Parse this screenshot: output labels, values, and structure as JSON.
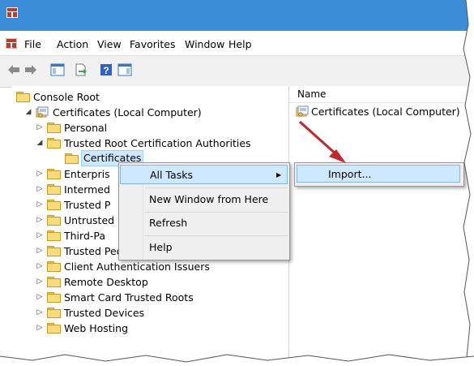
{
  "menu": [
    "File",
    "Action",
    "View",
    "Favorites",
    "Window",
    "Help"
  ],
  "toolbar": {
    "icons": [
      "back-arrow-icon",
      "forward-arrow-icon",
      "show-hide-tree-icon",
      "export-list-icon",
      "help-icon",
      "show-action-pane-icon"
    ]
  },
  "tree": [
    {
      "label": "Console Root",
      "indent": 0,
      "expander": "",
      "icon": "folder"
    },
    {
      "label": "Certificates (Local Computer)",
      "indent": 1,
      "expander": "◢",
      "icon": "cert"
    },
    {
      "label": "Personal",
      "indent": 2,
      "expander": "▷",
      "icon": "folder"
    },
    {
      "label": "Trusted Root Certification Authorities",
      "indent": 2,
      "expander": "◢",
      "icon": "folder"
    },
    {
      "label": "Certificates",
      "indent": 3,
      "expander": "",
      "icon": "folder",
      "selected": true
    },
    {
      "label": "Enterpris",
      "indent": 2,
      "expander": "▷",
      "icon": "folder"
    },
    {
      "label": "Intermed",
      "indent": 2,
      "expander": "▷",
      "icon": "folder"
    },
    {
      "label": "Trusted P",
      "indent": 2,
      "expander": "▷",
      "icon": "folder"
    },
    {
      "label": "Untrusted",
      "indent": 2,
      "expander": "▷",
      "icon": "folder"
    },
    {
      "label": "Third-Pa",
      "indent": 2,
      "expander": "▷",
      "icon": "folder"
    },
    {
      "label": "Trusted People",
      "indent": 2,
      "expander": "▷",
      "icon": "folder"
    },
    {
      "label": "Client Authentication Issuers",
      "indent": 2,
      "expander": "▷",
      "icon": "folder"
    },
    {
      "label": "Remote Desktop",
      "indent": 2,
      "expander": "▷",
      "icon": "folder"
    },
    {
      "label": "Smart Card Trusted Roots",
      "indent": 2,
      "expander": "▷",
      "icon": "folder"
    },
    {
      "label": "Trusted Devices",
      "indent": 2,
      "expander": "▷",
      "icon": "folder"
    },
    {
      "label": "Web Hosting",
      "indent": 2,
      "expander": "▷",
      "icon": "folder"
    }
  ],
  "right_pane": {
    "column_header": "Name",
    "items": [
      "Certificates (Local Computer)"
    ]
  },
  "context_menu": {
    "items": [
      "All Tasks",
      "New Window from Here",
      "Refresh",
      "Help"
    ],
    "submenu_arrow": "▶"
  },
  "submenu": {
    "items": [
      "Import..."
    ]
  },
  "colors": {
    "titlebar": "#3a8dd6",
    "highlight": "#cde8ff",
    "highlight_border": "#7fb7e9",
    "arrow": "#c0282b"
  }
}
